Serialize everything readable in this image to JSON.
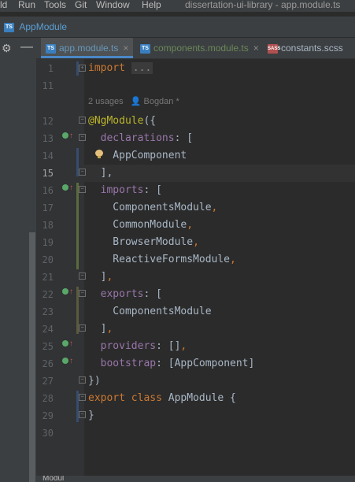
{
  "menu": {
    "items": [
      "ld",
      "Run",
      "Tools",
      "Git",
      "Window",
      "Help"
    ],
    "window_title": "dissertation-ui-library - app.module.ts"
  },
  "navbar": {
    "crumb": "AppModule",
    "badge": "TS"
  },
  "tabs": [
    {
      "name": "app.module.ts",
      "badge": "TS",
      "active": true
    },
    {
      "name": "components.module.ts",
      "badge": "TS",
      "active": false
    },
    {
      "name": "constants.scss",
      "badge": "SASS",
      "active": false
    }
  ],
  "inlay_hint": {
    "usages": "2 usages",
    "author": "Bogdan *"
  },
  "lines": [
    {
      "n": "1",
      "text": "import ..."
    },
    {
      "n": "11",
      "text": ""
    },
    {
      "n": "12",
      "text": "@NgModule({"
    },
    {
      "n": "13",
      "text": "  declarations: ["
    },
    {
      "n": "14",
      "text": "    AppComponent"
    },
    {
      "n": "15",
      "text": "  ],"
    },
    {
      "n": "16",
      "text": "  imports: ["
    },
    {
      "n": "17",
      "text": "    ComponentsModule,"
    },
    {
      "n": "18",
      "text": "    CommonModule,"
    },
    {
      "n": "19",
      "text": "    BrowserModule,"
    },
    {
      "n": "20",
      "text": "    ReactiveFormsModule,"
    },
    {
      "n": "21",
      "text": "  ],"
    },
    {
      "n": "22",
      "text": "  exports: ["
    },
    {
      "n": "23",
      "text": "    ComponentsModule"
    },
    {
      "n": "24",
      "text": "  ],"
    },
    {
      "n": "25",
      "text": "  providers: [],"
    },
    {
      "n": "26",
      "text": "  bootstrap: [AppComponent]"
    },
    {
      "n": "27",
      "text": "})"
    },
    {
      "n": "28",
      "text": "export class AppModule {"
    },
    {
      "n": "29",
      "text": "}"
    },
    {
      "n": "30",
      "text": ""
    }
  ],
  "colors": {
    "keyword": "#cc7832",
    "decorator": "#bbb529",
    "property": "#9876aa",
    "text": "#a9b7c6",
    "line_number": "#606366",
    "background": "#2b2b2b"
  },
  "bottom_label": "Modul"
}
